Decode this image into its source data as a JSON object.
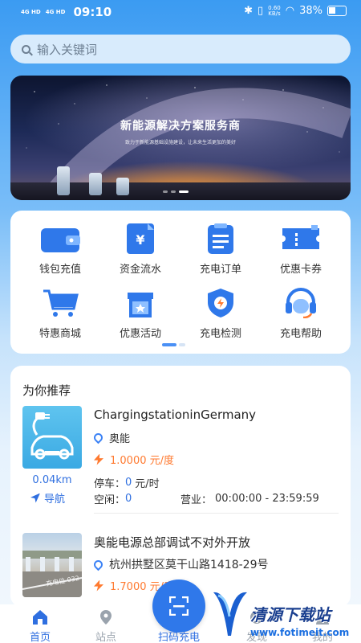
{
  "status_bar": {
    "signal_1": "4G HD",
    "signal_2": "4G HD",
    "time": "09:10",
    "speed_value": "0.60",
    "speed_unit": "KB/s",
    "battery": "38%"
  },
  "search": {
    "placeholder": "输入关键词"
  },
  "banner": {
    "title": "新能源解决方案服务商",
    "subtitle": "致力于新能源基础设施建设，让未来生活更加的美好"
  },
  "quick_grid": {
    "items": [
      {
        "label": "钱包充值",
        "icon": "wallet-icon"
      },
      {
        "label": "资金流水",
        "icon": "yuan-document-icon"
      },
      {
        "label": "充电订单",
        "icon": "order-list-icon"
      },
      {
        "label": "优惠卡券",
        "icon": "coupon-icon"
      },
      {
        "label": "特惠商城",
        "icon": "shopping-cart-icon"
      },
      {
        "label": "优惠活动",
        "icon": "gift-icon"
      },
      {
        "label": "充电检测",
        "icon": "shield-bolt-icon"
      },
      {
        "label": "充电帮助",
        "icon": "headset-icon"
      }
    ]
  },
  "recommend": {
    "title": "为你推荐",
    "stations": [
      {
        "name": "ChargingstationinGermany",
        "operator": "奥能",
        "price": "1.0000",
        "price_unit": "元/度",
        "distance": "0.04km",
        "navigate_label": "导航",
        "parking_label": "停车：",
        "parking_value": "0",
        "parking_unit": "元/时",
        "idle_label": "空闲：",
        "idle_value": "0",
        "hours_label": "营业：",
        "hours_value": "00:00:00 - 23:59:59"
      },
      {
        "name": "奥能电源总部调试不对外开放",
        "address": "杭州拱墅区莫干山路1418-29号",
        "price": "1.7000",
        "price_unit": "元/度",
        "image_text": "充电位 032"
      }
    ]
  },
  "tabbar": {
    "home": "首页",
    "stations": "站点",
    "scan": "扫码充电",
    "discover": "发现",
    "mine": "我的"
  },
  "watermark": {
    "text": "清源下载站",
    "url": "www.fotimeit.com"
  },
  "colors": {
    "accent": "#2f6fe0",
    "price": "#ff7a30",
    "background_top": "#3b9bf2"
  }
}
